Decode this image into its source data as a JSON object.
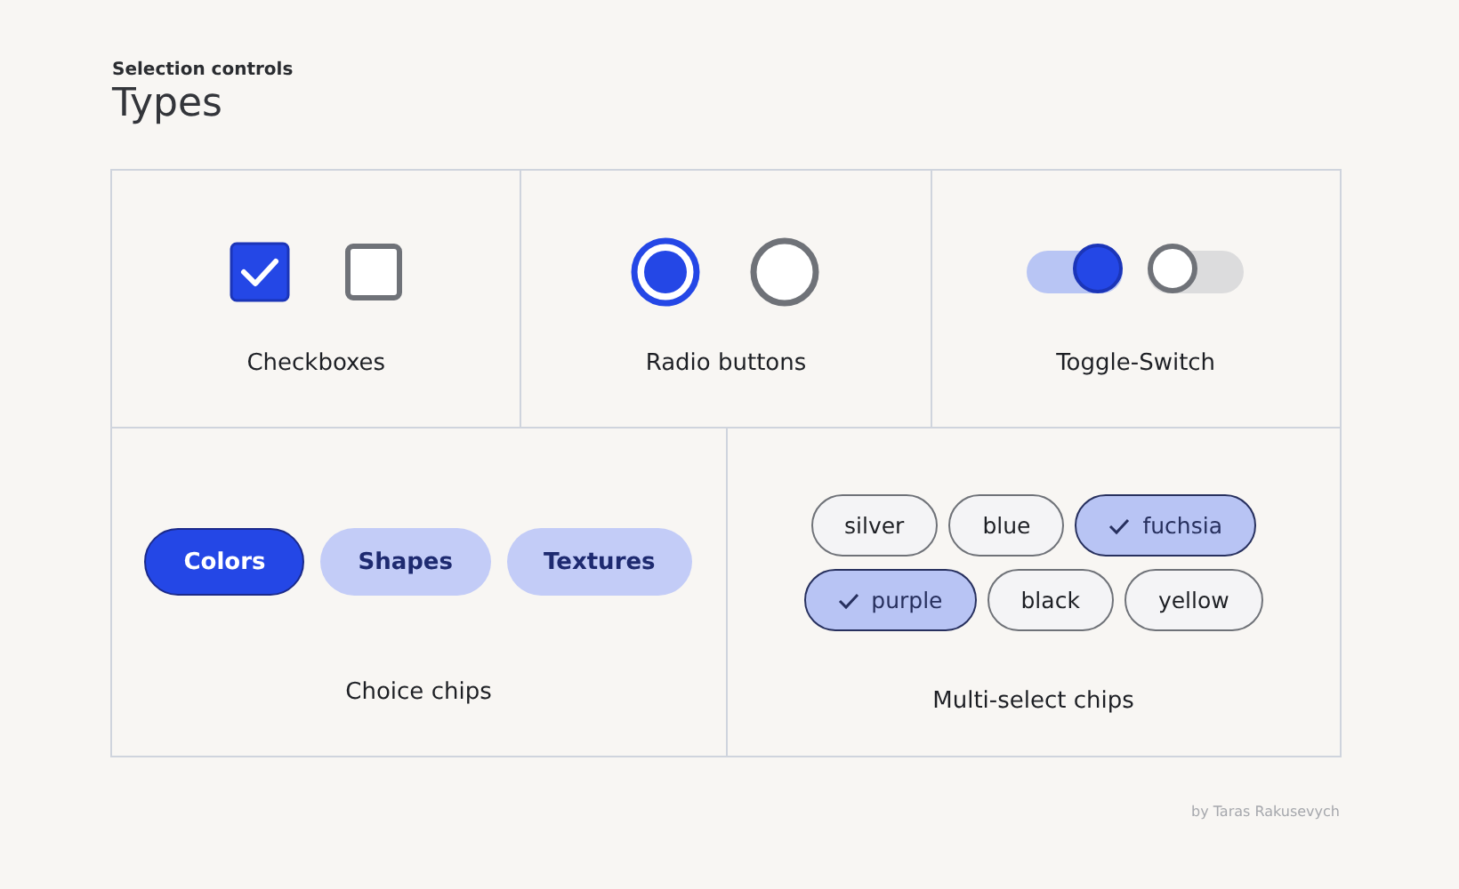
{
  "header": {
    "eyebrow": "Selection controls",
    "title": "Types"
  },
  "checkboxes": {
    "label": "Checkboxes",
    "items": [
      {
        "checked": true
      },
      {
        "checked": false
      }
    ]
  },
  "radios": {
    "label": "Radio buttons",
    "items": [
      {
        "selected": true
      },
      {
        "selected": false
      }
    ]
  },
  "toggles": {
    "label": "Toggle-Switch",
    "items": [
      {
        "on": true
      },
      {
        "on": false
      }
    ]
  },
  "choice_chips": {
    "label": "Choice chips",
    "items": [
      {
        "label": "Colors",
        "selected": true
      },
      {
        "label": "Shapes",
        "selected": false
      },
      {
        "label": "Textures",
        "selected": false
      }
    ]
  },
  "multi_chips": {
    "label": "Multi-select chips",
    "rows": [
      [
        {
          "label": "silver",
          "selected": false
        },
        {
          "label": "blue",
          "selected": false
        },
        {
          "label": "fuchsia",
          "selected": true
        }
      ],
      [
        {
          "label": "purple",
          "selected": true
        },
        {
          "label": "black",
          "selected": false
        },
        {
          "label": "yellow",
          "selected": false
        }
      ]
    ]
  },
  "credit": "by Taras Rakusevych"
}
